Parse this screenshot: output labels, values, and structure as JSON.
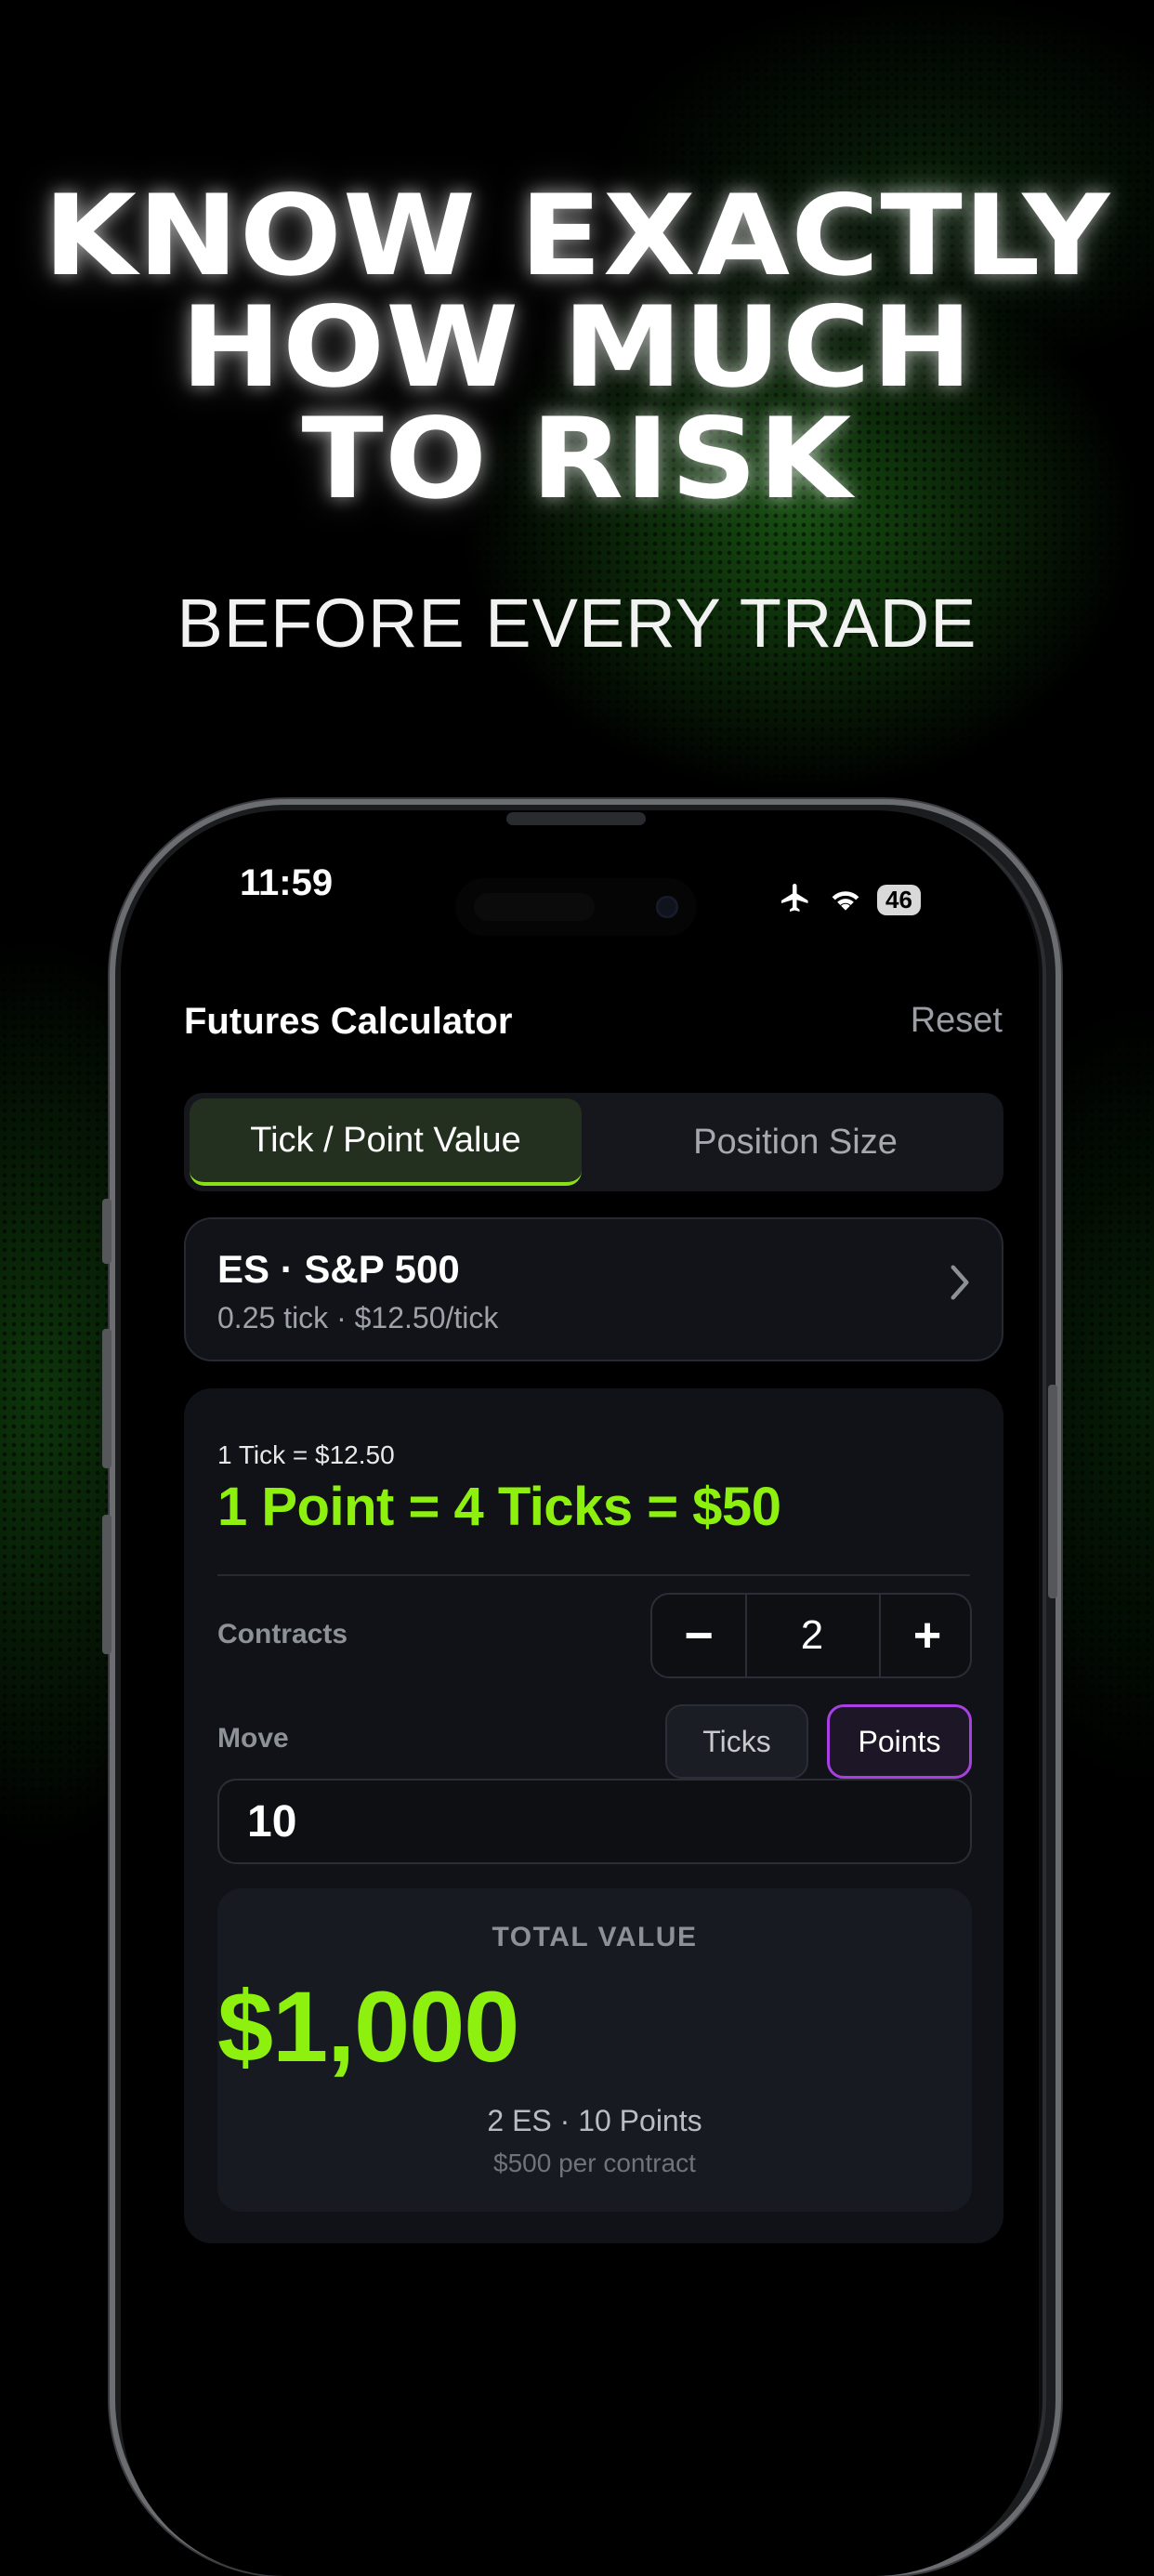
{
  "promo": {
    "headline_lines": [
      "KNOW EXACTLY",
      "HOW MUCH",
      "TO RISK"
    ],
    "subheadline": "BEFORE EVERY TRADE"
  },
  "status_bar": {
    "time": "11:59",
    "battery": "46",
    "icons": [
      "airplane-icon",
      "wifi-icon",
      "battery-icon"
    ]
  },
  "app": {
    "title": "Futures Calculator",
    "reset_label": "Reset",
    "tabs": [
      {
        "label": "Tick / Point Value",
        "active": true
      },
      {
        "label": "Position Size",
        "active": false
      }
    ],
    "instrument": {
      "name": "ES · S&P 500",
      "detail": "0.25 tick · $12.50/tick"
    },
    "calc": {
      "tick_line": "1 Tick = $12.50",
      "point_line": "1 Point = 4 Ticks = $50",
      "contracts_label": "Contracts",
      "contracts_value": "2",
      "minus_label": "−",
      "plus_label": "+",
      "move_label": "Move",
      "unit_ticks": "Ticks",
      "unit_points": "Points",
      "selected_unit": "Points",
      "move_value": "10"
    },
    "result": {
      "title": "TOTAL VALUE",
      "amount": "$1,000",
      "detail": "2 ES · 10 Points",
      "per_contract": "$500 per contract"
    }
  },
  "colors": {
    "accent_green": "#8ef00f",
    "accent_purple": "#a83fe0",
    "background": "#000000"
  }
}
